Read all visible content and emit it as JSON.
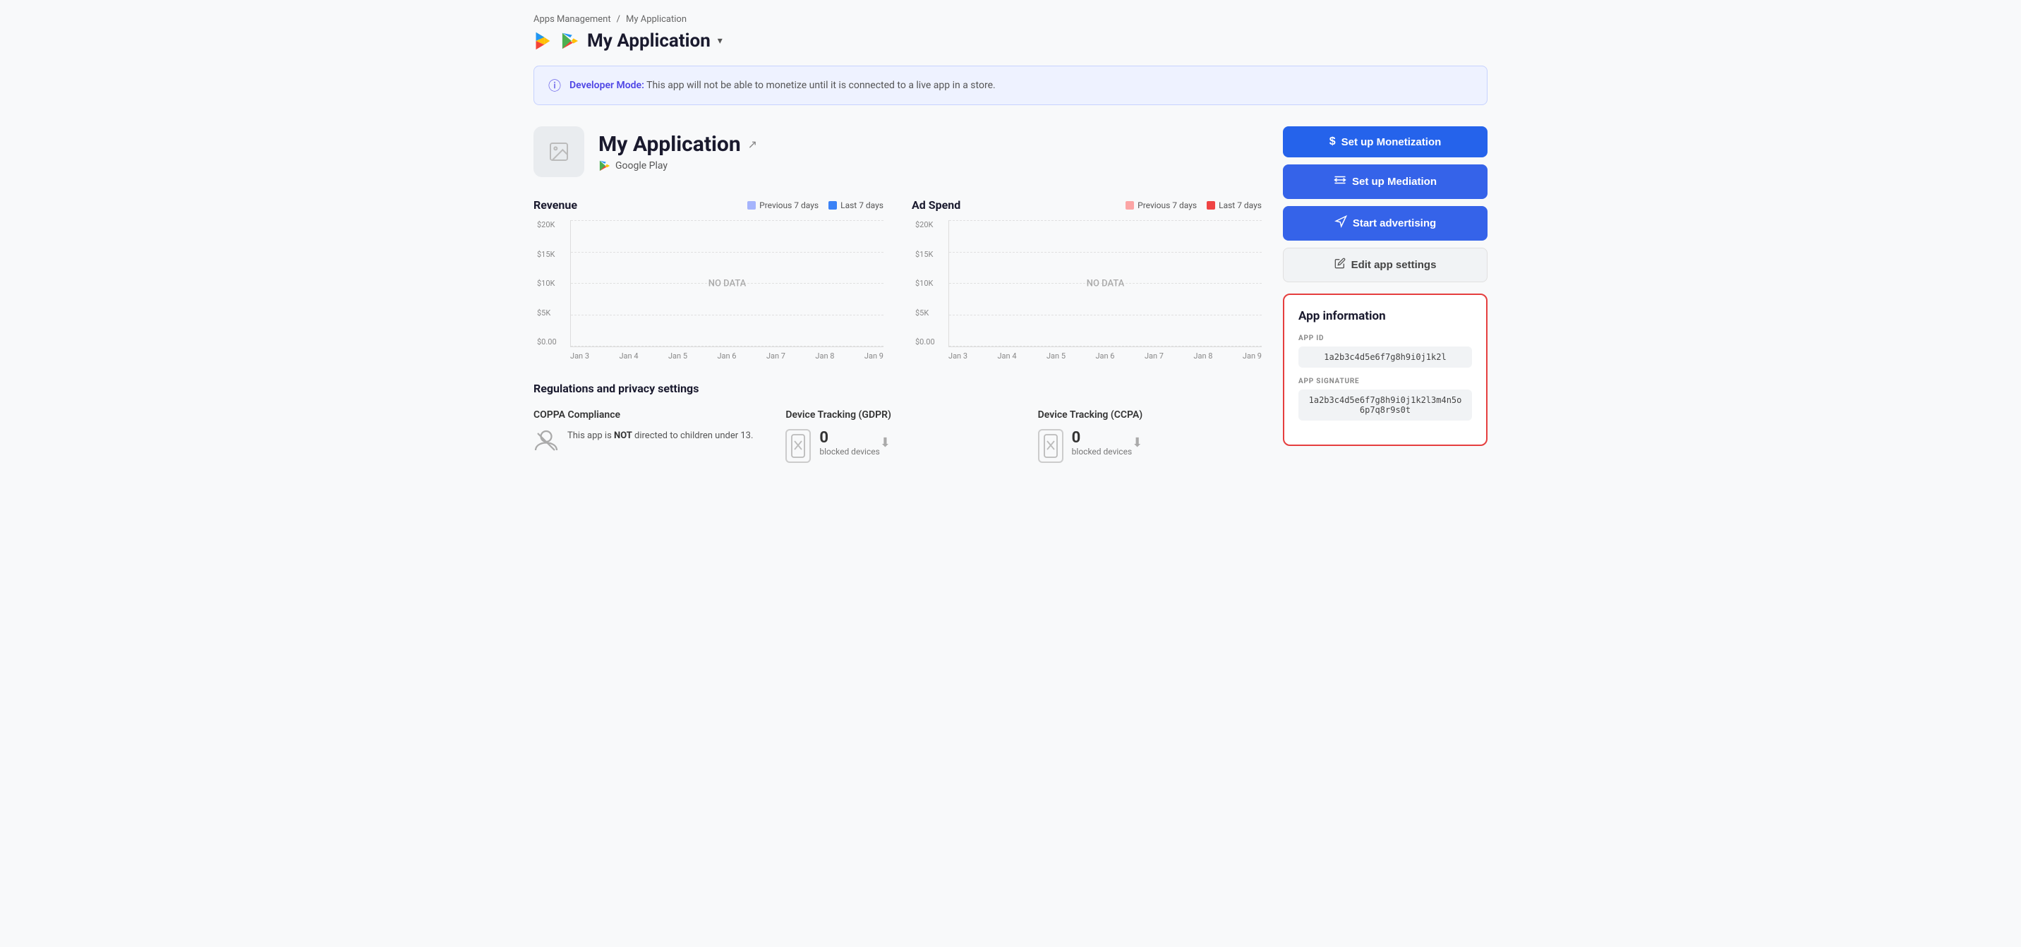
{
  "breadcrumb": {
    "parent": "Apps Management",
    "separator": "/",
    "current": "My Application"
  },
  "header": {
    "app_title": "My Application",
    "dropdown_arrow": "▾"
  },
  "dev_banner": {
    "icon": "ℹ",
    "label": "Developer Mode:",
    "text": " This app will not be able to monetize until it is connected to a live app in a store."
  },
  "app_card": {
    "name": "My Application",
    "store": "Google Play",
    "icon_placeholder": "🖼"
  },
  "buttons": {
    "monetization": "Set up Monetization",
    "mediation": "Set up Mediation",
    "advertising": "Start advertising",
    "edit_settings": "Edit app settings"
  },
  "revenue_chart": {
    "title": "Revenue",
    "legend_prev": "Previous 7 days",
    "legend_last": "Last 7 days",
    "prev_color": "#a5b4fc",
    "last_color": "#3b82f6",
    "no_data": "NO DATA",
    "y_labels": [
      "$20K",
      "$15K",
      "$10K",
      "$5K",
      "$0.00"
    ],
    "x_labels": [
      "Jan 3",
      "Jan 4",
      "Jan 5",
      "Jan 6",
      "Jan 7",
      "Jan 8",
      "Jan 9"
    ]
  },
  "adspend_chart": {
    "title": "Ad Spend",
    "legend_prev": "Previous 7 days",
    "legend_last": "Last 7 days",
    "prev_color": "#fca5a5",
    "last_color": "#ef4444",
    "no_data": "NO DATA",
    "y_labels": [
      "$20K",
      "$15K",
      "$10K",
      "$5K",
      "$0.00"
    ],
    "x_labels": [
      "Jan 3",
      "Jan 4",
      "Jan 5",
      "Jan 6",
      "Jan 7",
      "Jan 8",
      "Jan 9"
    ]
  },
  "app_information": {
    "title": "App information",
    "app_id_label": "APP ID",
    "app_id_value": "1a2b3c4d5e6f7g8h9i0j1k2l",
    "app_sig_label": "APP SIGNATURE",
    "app_sig_value": "1a2b3c4d5e6f7g8h9i0j1k2l3m4n5o6p7q8r9s0t"
  },
  "regulations": {
    "title": "Regulations and privacy settings",
    "coppa": {
      "title": "COPPA Compliance",
      "text": "This app is ",
      "bold": "NOT",
      "text2": " directed to children under 13."
    },
    "gdpr": {
      "title": "Device Tracking (GDPR)",
      "count": "0",
      "label": "blocked devices"
    },
    "ccpa": {
      "title": "Device Tracking (CCPA)",
      "count": "0",
      "label": "blocked devices"
    }
  }
}
